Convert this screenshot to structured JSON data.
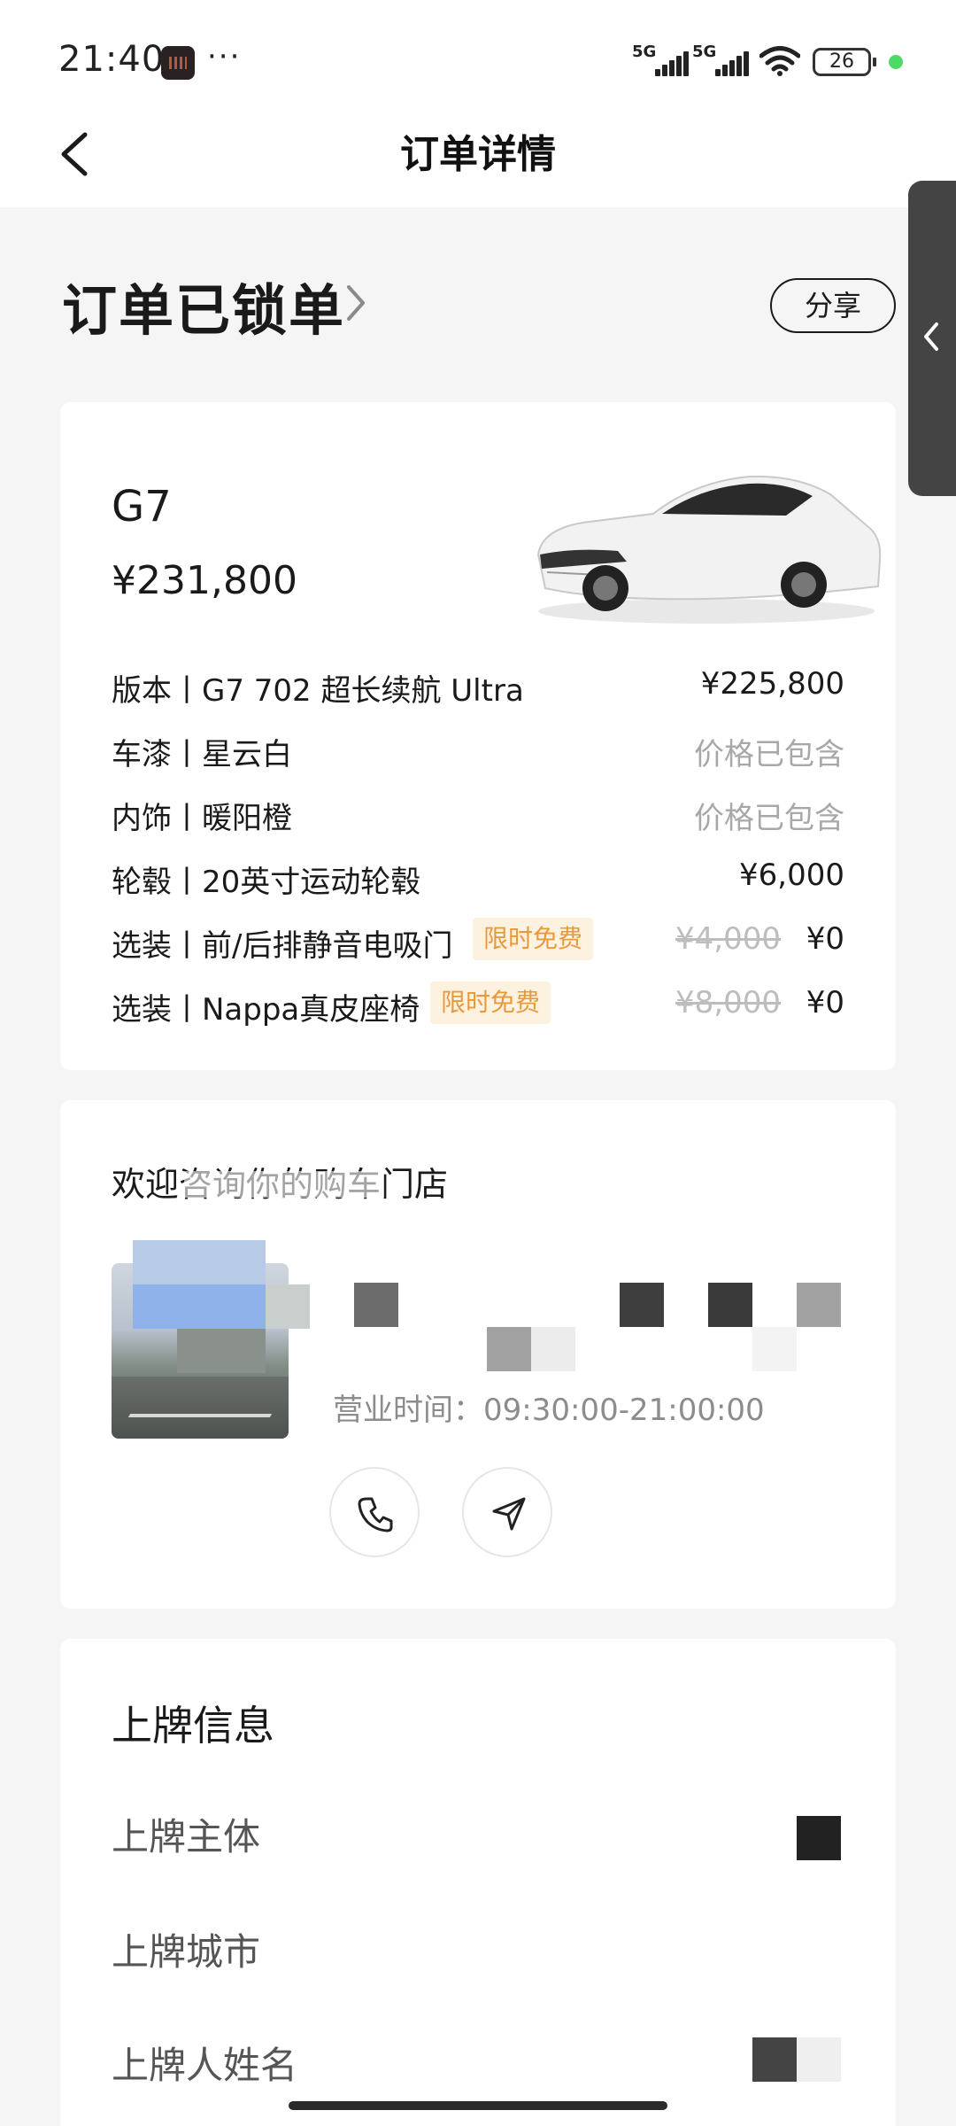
{
  "status_bar": {
    "time": "21:40",
    "more": "···",
    "net1": "5G",
    "net2": "5G",
    "battery": "26"
  },
  "nav": {
    "title": "订单详情",
    "back_icon": "chevron-left-icon"
  },
  "order": {
    "status_title": "订单已锁单",
    "share_label": "分享"
  },
  "vehicle": {
    "model": "G7",
    "total_price": "¥231,800",
    "items": [
      {
        "label": "版本丨G7 702 超长续航 Ultra",
        "value": "¥225,800",
        "muted": false
      },
      {
        "label": "车漆丨星云白",
        "value": "价格已包含",
        "muted": true
      },
      {
        "label": "内饰丨暖阳橙",
        "value": "价格已包含",
        "muted": true
      },
      {
        "label": "轮毂丨20英寸运动轮毂",
        "value": "¥6,000",
        "muted": false
      },
      {
        "label": "选装丨前/后排静音电吸门",
        "tag": "限时免费",
        "original": "¥4,000",
        "value": "¥0"
      },
      {
        "label": "选装丨Nappa真皮座椅",
        "tag": "限时免费",
        "original": "¥8,000",
        "value": "¥0"
      }
    ]
  },
  "store": {
    "title": "欢迎咨询你的购车门店",
    "hours": "营业时间：09:30:00-21:00:00",
    "call_icon": "phone-icon",
    "nav_icon": "navigation-arrow-icon"
  },
  "registration": {
    "title": "上牌信息",
    "rows": [
      {
        "label": "上牌主体"
      },
      {
        "label": "上牌城市"
      },
      {
        "label": "上牌人姓名"
      }
    ]
  }
}
